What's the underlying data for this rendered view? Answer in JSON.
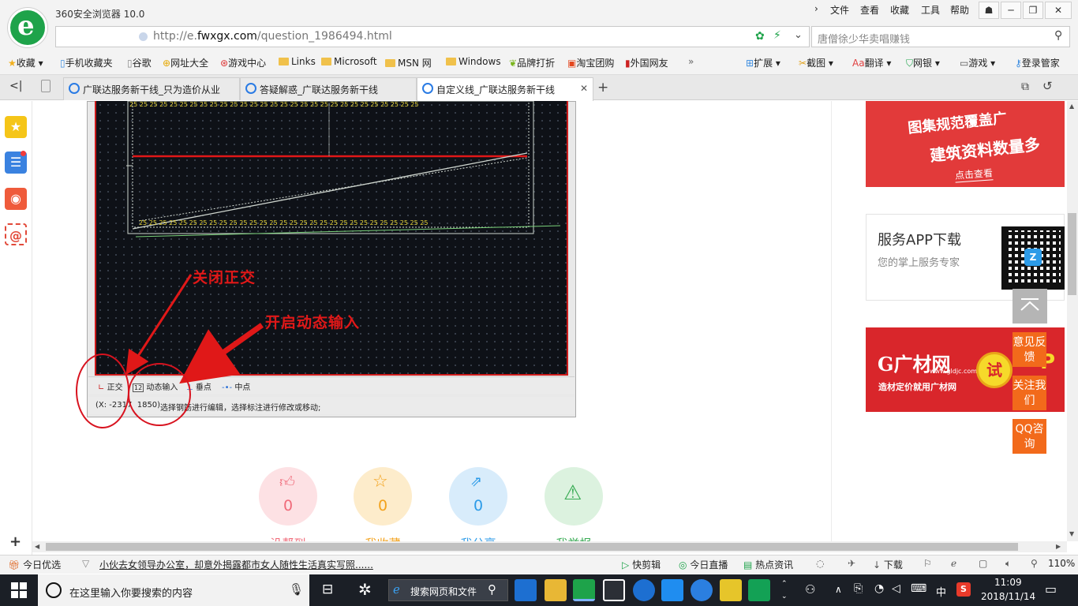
{
  "browser": {
    "app_title": "360安全浏览器 10.0",
    "menu": [
      "文件",
      "查看",
      "收藏",
      "工具",
      "帮助"
    ],
    "url_prefix": "http://e.",
    "url_domain": "fwxgx.com",
    "url_path": "/question_1986494.html",
    "search_placeholder": "唐僧徐少华卖唱赚钱"
  },
  "bookmarks": {
    "favorites": "收藏",
    "items": [
      "手机收藏夹",
      "谷歌",
      "网址大全",
      "游戏中心",
      "Links",
      "Microsoft",
      "MSN 网",
      "Windows",
      "品牌打折",
      "淘宝团购",
      "外国网友"
    ],
    "more": "»",
    "tools": [
      "扩展",
      "截图",
      "翻译",
      "网银",
      "游戏",
      "登录管家"
    ]
  },
  "tabs": [
    {
      "title": "广联达服务新干线_只为造价从业"
    },
    {
      "title": "答疑解惑_广联达服务新干线"
    },
    {
      "title": "自定义线_广联达服务新干线"
    }
  ],
  "cad": {
    "rebar_labels": "25 25 25 25 25 25 25 25 25 25 25 25 25 25 25 25 25 25 25 25 25 25 25 25 25 25 25 25 25",
    "annotation_ortho": "关闭正交",
    "annotation_dynamic": "开启动态输入",
    "status_ortho": "正交",
    "status_dynamic": "动态输入",
    "status_perp": "垂点",
    "status_mid": "中点",
    "coords": "(X: -2317",
    "coords_end": "1850)",
    "hint": "选择钢筋进行编辑，选择标注进行修改或移动;"
  },
  "reactions": [
    {
      "count": "0",
      "label": "没帮到",
      "color": "#f06b7a"
    },
    {
      "count": "0",
      "label": "我收藏",
      "color": "#f3a21c"
    },
    {
      "count": "0",
      "label": "我分享",
      "color": "#2c9be8"
    },
    {
      "count": "",
      "label": "我举报",
      "color": "#3aac55"
    }
  ],
  "ads": {
    "ad1_line1": "图集规范覆盖广",
    "ad1_line2": "建筑资料数量多",
    "ad1_cta": "点击查看",
    "app_title": "服务APP下载",
    "app_sub": "您的掌上服务专家",
    "ad2_brand": "广材网",
    "ad2_url": "www.gldjc.com",
    "ad2_slogan": "造材定价就用广材网",
    "ad2_badge": "试",
    "ad2_partial": "P"
  },
  "float_buttons": [
    "意见反馈",
    "关注我们",
    "QQ咨询"
  ],
  "status_bar": {
    "left": "今日优选",
    "news": "小伙去女领导办公室，却意外揭露都市女人随性生活真实写照......",
    "items": [
      "快剪辑",
      "今日直播",
      "热点资讯",
      "下载"
    ],
    "zoom": "110%"
  },
  "taskbar": {
    "search_placeholder": "在这里输入你要搜索的内容",
    "web_search": "搜索网页和文件",
    "ime": "中",
    "time": "11:09",
    "date": "2018/11/14"
  }
}
